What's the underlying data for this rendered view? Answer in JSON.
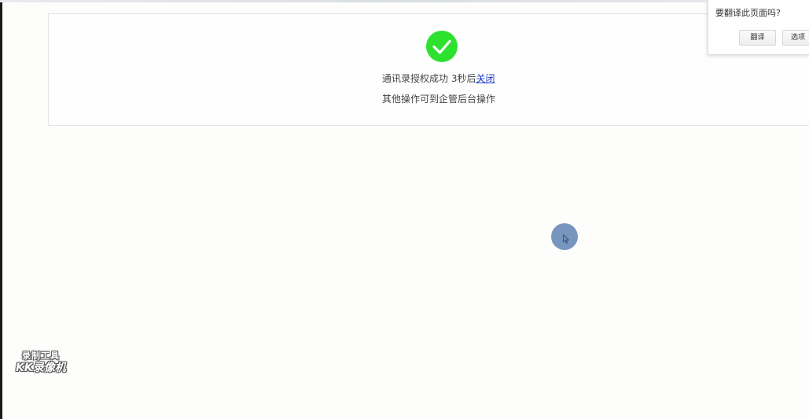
{
  "status": {
    "message_prefix": "通讯录授权成功 3秒后",
    "close_link": "关闭",
    "secondary_message": "其他操作可到企管后台操作",
    "icon": "checkmark-icon",
    "icon_color": "#2ee12e"
  },
  "translate_popup": {
    "title": "要翻译此页面吗?",
    "translate_button": "翻译",
    "options_button": "选项"
  },
  "watermark": {
    "line1": "录制工具",
    "line2": "KK录像机"
  },
  "colors": {
    "link": "#1d3cc8",
    "cursor_highlight": "#6084b2"
  }
}
